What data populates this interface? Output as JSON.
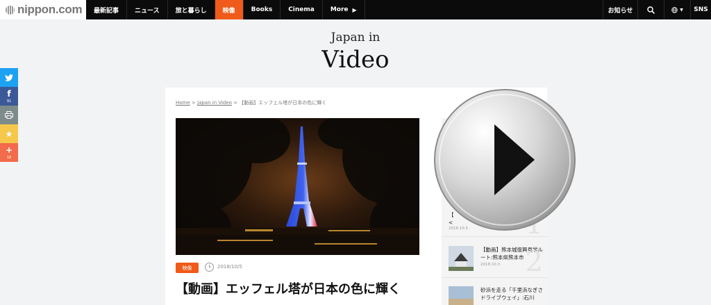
{
  "logo": {
    "text": "nippon.com"
  },
  "nav": [
    {
      "label": "最新記事",
      "active": false
    },
    {
      "label": "ニュース",
      "active": false
    },
    {
      "label": "旅と暮らし",
      "active": false
    },
    {
      "label": "映像",
      "active": true
    },
    {
      "label": "Books",
      "active": false
    },
    {
      "label": "Cinema",
      "active": false
    },
    {
      "label": "More",
      "active": false
    }
  ],
  "nav_right": {
    "notice": "お知らせ",
    "search_icon": "search-icon",
    "lang_icon": "globe-icon",
    "sns": "SNS"
  },
  "share": [
    {
      "icon": "twitter-icon",
      "count": "",
      "color": "#1da1f2"
    },
    {
      "icon": "facebook-icon",
      "count": "91",
      "color": "#3b5998"
    },
    {
      "icon": "print-icon",
      "count": "",
      "color": "#7d8c8a"
    },
    {
      "icon": "star-icon",
      "count": "",
      "color": "#f5c84c"
    },
    {
      "icon": "plus-icon",
      "count": "18",
      "color": "#f26b4a"
    }
  ],
  "header": {
    "small": "Japan in",
    "big": "Video"
  },
  "breadcrumb": {
    "home": "Home",
    "sep": " > ",
    "section": "Japan in Video",
    "current": "【動画】エッフェル塔が日本の色に輝く"
  },
  "article": {
    "category": "映像",
    "date": "2018/10/5",
    "title": "【動画】エッフェル塔が日本の色に輝く"
  },
  "ranking": [
    {
      "title": "【\n<",
      "date": "2018.10.5",
      "num": "1"
    },
    {
      "title": "【動画】熊本城復興見学ルート:熊本県熊本市",
      "date": "2018.10.3",
      "num": "2"
    },
    {
      "title": "砂浜を走る「千里浜なぎさドライブウェイ」:石川",
      "date": "",
      "num": ""
    }
  ],
  "overlay": {
    "icon": "play-icon"
  },
  "colors": {
    "accent": "#f05a1a",
    "nav_bg": "#0b0b0b"
  }
}
